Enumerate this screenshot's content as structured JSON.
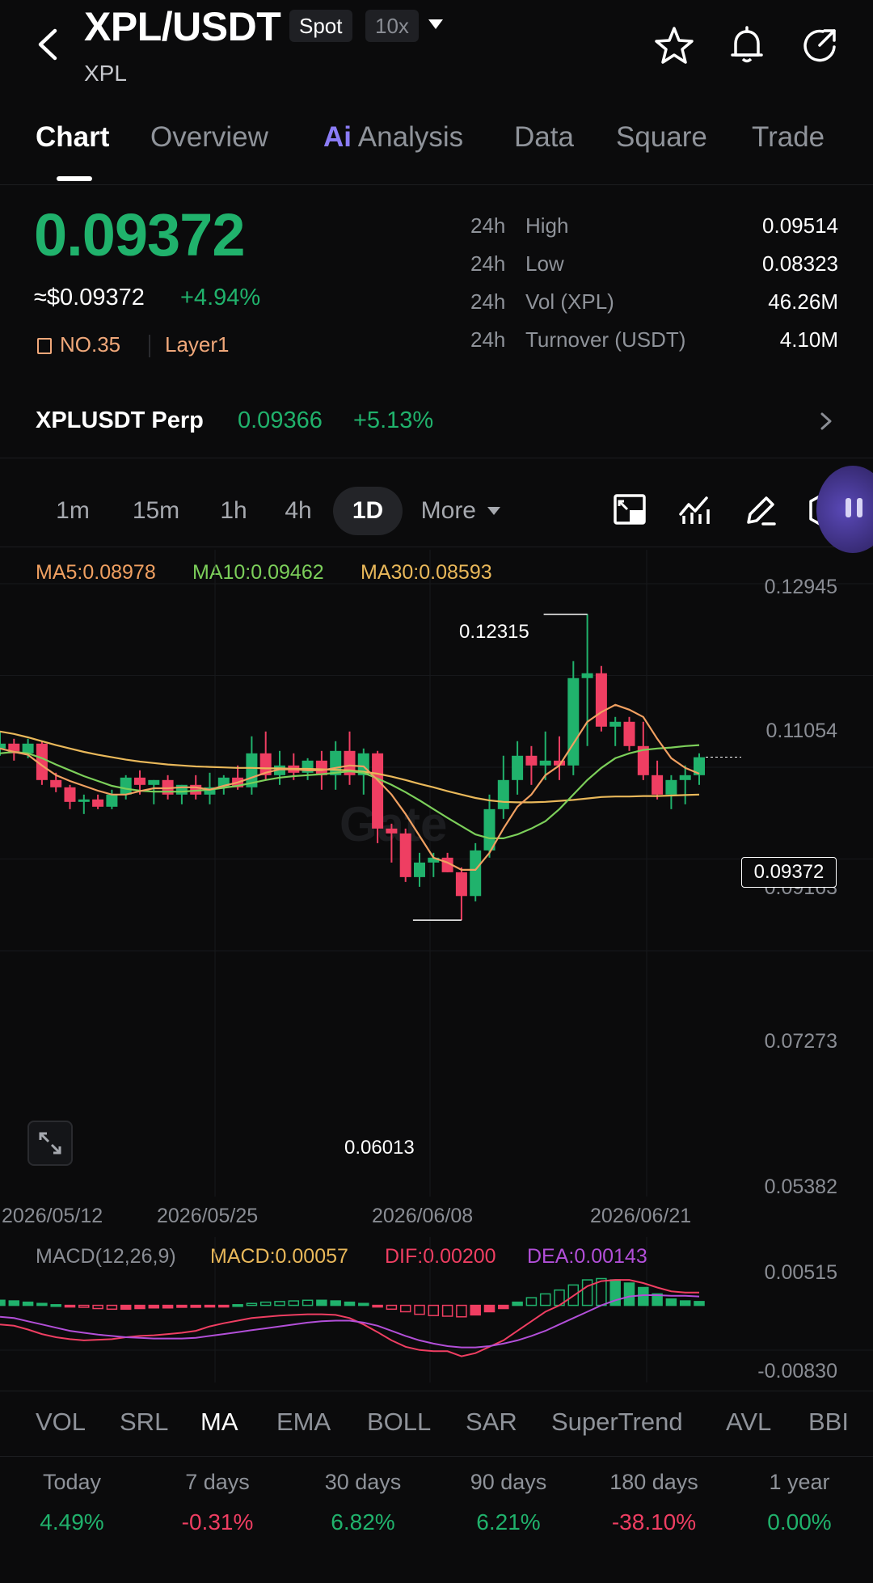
{
  "header": {
    "title": "XPL/USDT",
    "market_badge": "Spot",
    "leverage_badge": "10x",
    "subtitle": "XPL"
  },
  "tabs": [
    {
      "label": "Chart",
      "active": true
    },
    {
      "label": "Overview"
    },
    {
      "label": "Analysis",
      "prefix": "Ai"
    },
    {
      "label": "Data"
    },
    {
      "label": "Square"
    },
    {
      "label": "Trade"
    }
  ],
  "price": {
    "last": "0.09372",
    "usd": "≈$0.09372",
    "change": "+4.94%",
    "rank": "NO.35",
    "category": "Layer1"
  },
  "stats": [
    {
      "period": "24h",
      "label": "High",
      "value": "0.09514"
    },
    {
      "period": "24h",
      "label": "Low",
      "value": "0.08323"
    },
    {
      "period": "24h",
      "label": "Vol (XPL)",
      "value": "46.26M"
    },
    {
      "period": "24h",
      "label": "Turnover (USDT)",
      "value": "4.10M"
    }
  ],
  "perp": {
    "symbol": "XPLUSDT Perp",
    "price": "0.09366",
    "change": "+5.13%"
  },
  "intervals": [
    "1m",
    "15m",
    "1h",
    "4h",
    "1D"
  ],
  "interval_selected": "1D",
  "more_label": "More",
  "ma_legend": {
    "ma5": "MA5:0.08978",
    "ma10": "MA10:0.09462",
    "ma30": "MA30:0.08593"
  },
  "chart_tooltips": {
    "high": "0.12315",
    "low": "0.06013",
    "current": "0.09372"
  },
  "watermark": "Gate",
  "colors": {
    "up": "#20b26c",
    "down": "#ef3e62",
    "ma5": "#f0a061",
    "ma10": "#7ccf5a",
    "ma30": "#e9b85a",
    "dif": "#ef3e62",
    "dea": "#b24fd8",
    "macd": "#e9b85a"
  },
  "macd_legend": {
    "name": "MACD(12,26,9)",
    "macd": "MACD:0.00057",
    "dif": "DIF:0.00200",
    "dea": "DEA:0.00143"
  },
  "indicator_tabs": [
    "VOL",
    "SRL",
    "MA",
    "EMA",
    "BOLL",
    "SAR",
    "SuperTrend",
    "AVL",
    "BBI"
  ],
  "indicator_selected": "MA",
  "performance": [
    {
      "label": "Today",
      "value": "4.49%"
    },
    {
      "label": "7 days",
      "value": "-0.31%"
    },
    {
      "label": "30 days",
      "value": "6.82%"
    },
    {
      "label": "90 days",
      "value": "6.21%"
    },
    {
      "label": "180 days",
      "value": "-38.10%"
    },
    {
      "label": "1 year",
      "value": "0.00%"
    }
  ],
  "chart_data": {
    "type": "candlestick",
    "y_ticks": [
      "0.12945",
      "0.11054",
      "0.09163",
      "0.07273",
      "0.05382"
    ],
    "ylim": [
      0.05382,
      0.12945
    ],
    "x_ticks": [
      "2026/05/12",
      "2026/05/25",
      "2026/06/08",
      "2026/06/21"
    ],
    "candles": [
      [
        0.0955,
        0.099,
        0.094,
        0.0965
      ],
      [
        0.0965,
        0.0975,
        0.093,
        0.0945
      ],
      [
        0.0945,
        0.0975,
        0.0935,
        0.0965
      ],
      [
        0.0965,
        0.097,
        0.088,
        0.089
      ],
      [
        0.089,
        0.0905,
        0.0865,
        0.0875
      ],
      [
        0.0875,
        0.088,
        0.083,
        0.0845
      ],
      [
        0.0845,
        0.086,
        0.082,
        0.085
      ],
      [
        0.085,
        0.086,
        0.083,
        0.0835
      ],
      [
        0.0835,
        0.087,
        0.083,
        0.086
      ],
      [
        0.086,
        0.09,
        0.085,
        0.0895
      ],
      [
        0.0895,
        0.091,
        0.086,
        0.088
      ],
      [
        0.088,
        0.089,
        0.084,
        0.089
      ],
      [
        0.089,
        0.09,
        0.085,
        0.086
      ],
      [
        0.086,
        0.088,
        0.084,
        0.088
      ],
      [
        0.088,
        0.09,
        0.085,
        0.086
      ],
      [
        0.086,
        0.0905,
        0.084,
        0.0875
      ],
      [
        0.0875,
        0.09,
        0.086,
        0.0895
      ],
      [
        0.0895,
        0.092,
        0.087,
        0.0875
      ],
      [
        0.0875,
        0.098,
        0.086,
        0.0945
      ],
      [
        0.0945,
        0.099,
        0.089,
        0.09
      ],
      [
        0.09,
        0.095,
        0.088,
        0.092
      ],
      [
        0.092,
        0.0945,
        0.089,
        0.0905
      ],
      [
        0.0905,
        0.0935,
        0.089,
        0.093
      ],
      [
        0.093,
        0.095,
        0.087,
        0.09
      ],
      [
        0.09,
        0.097,
        0.087,
        0.095
      ],
      [
        0.095,
        0.099,
        0.088,
        0.09
      ],
      [
        0.09,
        0.0955,
        0.086,
        0.0945
      ],
      [
        0.0945,
        0.095,
        0.076,
        0.079
      ],
      [
        0.079,
        0.08,
        0.072,
        0.078
      ],
      [
        0.078,
        0.079,
        0.068,
        0.069
      ],
      [
        0.069,
        0.074,
        0.067,
        0.072
      ],
      [
        0.072,
        0.074,
        0.069,
        0.073
      ],
      [
        0.073,
        0.074,
        0.07,
        0.07
      ],
      [
        0.07,
        0.071,
        0.0601,
        0.0651
      ],
      [
        0.0651,
        0.076,
        0.064,
        0.0745
      ],
      [
        0.0745,
        0.086,
        0.073,
        0.083
      ],
      [
        0.083,
        0.094,
        0.081,
        0.089
      ],
      [
        0.089,
        0.097,
        0.086,
        0.094
      ],
      [
        0.094,
        0.096,
        0.088,
        0.092
      ],
      [
        0.092,
        0.099,
        0.089,
        0.093
      ],
      [
        0.093,
        0.098,
        0.089,
        0.092
      ],
      [
        0.092,
        0.1135,
        0.09,
        0.11
      ],
      [
        0.11,
        0.1232,
        0.096,
        0.111
      ],
      [
        0.111,
        0.1125,
        0.099,
        0.1
      ],
      [
        0.1,
        0.102,
        0.096,
        0.101
      ],
      [
        0.101,
        0.102,
        0.095,
        0.096
      ],
      [
        0.096,
        0.101,
        0.089,
        0.09
      ],
      [
        0.09,
        0.093,
        0.085,
        0.086
      ],
      [
        0.086,
        0.09,
        0.083,
        0.089
      ],
      [
        0.089,
        0.092,
        0.084,
        0.09
      ],
      [
        0.09,
        0.0945,
        0.088,
        0.0937
      ]
    ],
    "ma5": [
      0.0955,
      0.0948,
      0.0942,
      0.092,
      0.09,
      0.0888,
      0.0878,
      0.0868,
      0.086,
      0.086,
      0.0867,
      0.0873,
      0.0873,
      0.0875,
      0.0875,
      0.087,
      0.0878,
      0.0885,
      0.0895,
      0.0905,
      0.0912,
      0.0912,
      0.091,
      0.091,
      0.0915,
      0.092,
      0.0918,
      0.089,
      0.086,
      0.082,
      0.0775,
      0.073,
      0.072,
      0.0705,
      0.0705,
      0.074,
      0.079,
      0.0835,
      0.086,
      0.09,
      0.092,
      0.0965,
      0.101,
      0.103,
      0.1045,
      0.1035,
      0.102,
      0.0975,
      0.0935,
      0.0915,
      0.0903
    ],
    "ma10": [
      0.0945,
      0.0948,
      0.0945,
      0.0935,
      0.0922,
      0.091,
      0.0898,
      0.0888,
      0.0878,
      0.0872,
      0.0868,
      0.0866,
      0.0866,
      0.0866,
      0.0868,
      0.087,
      0.0874,
      0.0878,
      0.0884,
      0.089,
      0.0895,
      0.0898,
      0.09,
      0.0902,
      0.0905,
      0.0908,
      0.0905,
      0.0893,
      0.088,
      0.0865,
      0.0848,
      0.083,
      0.0812,
      0.0795,
      0.0778,
      0.077,
      0.077,
      0.0778,
      0.079,
      0.0805,
      0.083,
      0.086,
      0.089,
      0.0915,
      0.0935,
      0.0945,
      0.0952,
      0.0955,
      0.0957,
      0.096,
      0.0962
    ],
    "ma30": [
      0.099,
      0.0985,
      0.0978,
      0.097,
      0.0962,
      0.0955,
      0.0948,
      0.0942,
      0.0937,
      0.0932,
      0.0928,
      0.0925,
      0.0922,
      0.092,
      0.0918,
      0.0917,
      0.0916,
      0.0915,
      0.0915,
      0.0914,
      0.0914,
      0.0913,
      0.0913,
      0.0912,
      0.0911,
      0.091,
      0.0907,
      0.0903,
      0.0897,
      0.089,
      0.0882,
      0.0875,
      0.0867,
      0.086,
      0.0853,
      0.0848,
      0.0845,
      0.0844,
      0.0844,
      0.0845,
      0.0847,
      0.0849,
      0.0852,
      0.0855,
      0.0856,
      0.0856,
      0.0857,
      0.0857,
      0.0858,
      0.0859,
      0.086
    ],
    "macd_ylim": [
      -0.0083,
      0.00515
    ],
    "macd_y_ticks": [
      "0.00515",
      "-0.00830"
    ],
    "macd_hist": [
      0.0008,
      0.0007,
      0.0005,
      0.0003,
      0.0001,
      -0.0001,
      -0.0003,
      -0.0005,
      -0.0006,
      -0.0006,
      -0.0005,
      -0.0004,
      -0.0004,
      -0.0003,
      -0.0003,
      -0.0002,
      -0.0001,
      0.0001,
      0.0003,
      0.0005,
      0.0006,
      0.0007,
      0.0008,
      0.0008,
      0.0007,
      0.0005,
      0.0003,
      -0.0002,
      -0.0006,
      -0.001,
      -0.0014,
      -0.0016,
      -0.0017,
      -0.0018,
      -0.0015,
      -0.001,
      -0.0005,
      0.0005,
      0.0012,
      0.0018,
      0.0024,
      0.0032,
      0.004,
      0.0042,
      0.004,
      0.0035,
      0.0028,
      0.0018,
      0.001,
      0.0007,
      0.0006
    ],
    "macd_dif": [
      -0.003,
      -0.0032,
      -0.0038,
      -0.0045,
      -0.005,
      -0.0053,
      -0.0055,
      -0.0054,
      -0.0053,
      -0.005,
      -0.0048,
      -0.0047,
      -0.0045,
      -0.0043,
      -0.004,
      -0.0033,
      -0.0028,
      -0.0024,
      -0.002,
      -0.0018,
      -0.0016,
      -0.0015,
      -0.0014,
      -0.0014,
      -0.0015,
      -0.002,
      -0.003,
      -0.0042,
      -0.0055,
      -0.0065,
      -0.007,
      -0.0072,
      -0.0072,
      -0.008,
      -0.0075,
      -0.0065,
      -0.0055,
      -0.004,
      -0.0025,
      -0.001,
      0.0,
      0.0015,
      0.003,
      0.0038,
      0.004,
      0.004,
      0.0035,
      0.0028,
      0.0022,
      0.002,
      0.002
    ],
    "macd_dea": [
      -0.0018,
      -0.002,
      -0.0025,
      -0.003,
      -0.0035,
      -0.004,
      -0.0043,
      -0.0046,
      -0.0048,
      -0.005,
      -0.0051,
      -0.0052,
      -0.0052,
      -0.0052,
      -0.0051,
      -0.0048,
      -0.0045,
      -0.0042,
      -0.0039,
      -0.0036,
      -0.0033,
      -0.003,
      -0.0027,
      -0.0025,
      -0.0024,
      -0.0024,
      -0.0027,
      -0.0032,
      -0.004,
      -0.0048,
      -0.0055,
      -0.006,
      -0.0064,
      -0.0066,
      -0.0066,
      -0.0064,
      -0.006,
      -0.0055,
      -0.0048,
      -0.004,
      -0.003,
      -0.002,
      -0.001,
      0.0,
      0.0008,
      0.0014,
      0.0016,
      0.0016,
      0.0015,
      0.0015,
      0.0014
    ]
  }
}
